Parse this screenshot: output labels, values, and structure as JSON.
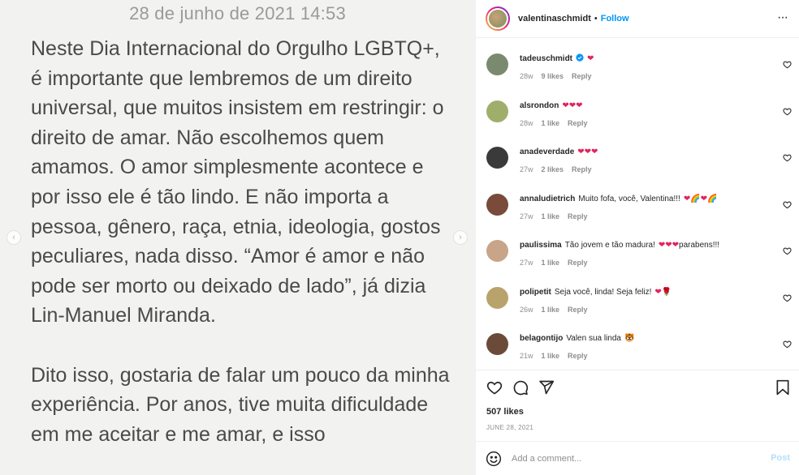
{
  "post_image": {
    "date": "28 de junho de 2021 14:53",
    "paragraphs": [
      "Neste Dia Internacional do Orgulho LGBTQ+, é importante que lembremos de um direito universal, que muitos insistem em restringir: o direito de amar. Não escolhemos quem amamos. O amor simplesmente acontece e por isso ele é tão lindo. E não importa a pessoa, gênero, raça, etnia, ideologia, gostos peculiares, nada disso. “Amor é amor e não pode ser morto ou deixado de lado”, já dizia Lin-Manuel Miranda.",
      "Dito isso, gostaria de falar um pouco da minha experiência. Por anos, tive muita dificuldade em me aceitar e me amar, e isso"
    ],
    "prev_glyph": "‹",
    "next_glyph": "›"
  },
  "header": {
    "username": "valentinaschmidt",
    "separator": "•",
    "follow_label": "Follow",
    "more_glyph": "···"
  },
  "comments": [
    {
      "user": "tadeuschmidt",
      "text": "",
      "emoji": "❤",
      "time": "28w",
      "likes": "9 likes",
      "reply": "Reply",
      "verified": true,
      "avatar_color": "#7a8a6e"
    },
    {
      "user": "alsrondon",
      "text": "",
      "emoji": "❤❤❤",
      "time": "28w",
      "likes": "1 like",
      "reply": "Reply",
      "verified": false,
      "avatar_color": "#9fae6a"
    },
    {
      "user": "anadeverdade",
      "text": "",
      "emoji": "❤❤❤",
      "time": "27w",
      "likes": "2 likes",
      "reply": "Reply",
      "verified": false,
      "avatar_color": "#3a3a3a"
    },
    {
      "user": "annaludietrich",
      "text": "Muito fofa, você, Valentina!!!",
      "emoji": "❤🌈❤🌈",
      "time": "27w",
      "likes": "1 like",
      "reply": "Reply",
      "verified": false,
      "avatar_color": "#7a4a3a"
    },
    {
      "user": "paulissima",
      "text": "Tão jovem e tão madura!",
      "emoji": "❤❤❤",
      "text_after": "parabens!!!",
      "time": "27w",
      "likes": "1 like",
      "reply": "Reply",
      "verified": false,
      "avatar_color": "#c8a488"
    },
    {
      "user": "polipetit",
      "text": "Seja você, linda! Seja feliz!",
      "emoji": "❤🌹",
      "time": "26w",
      "likes": "1 like",
      "reply": "Reply",
      "verified": false,
      "avatar_color": "#b9a36c"
    },
    {
      "user": "belagontijo",
      "text": "Valen sua linda",
      "emoji": "🐯",
      "time": "21w",
      "likes": "1 like",
      "reply": "Reply",
      "verified": false,
      "avatar_color": "#6b4a3a"
    }
  ],
  "actions": {
    "likes": "507 likes",
    "post_time": "JUNE 28, 2021"
  },
  "add_comment": {
    "placeholder": "Add a comment...",
    "post_label": "Post"
  },
  "colors": {
    "accent": "#0095f6",
    "post_disabled": "#b2dffc",
    "heart": "#e0245e"
  }
}
